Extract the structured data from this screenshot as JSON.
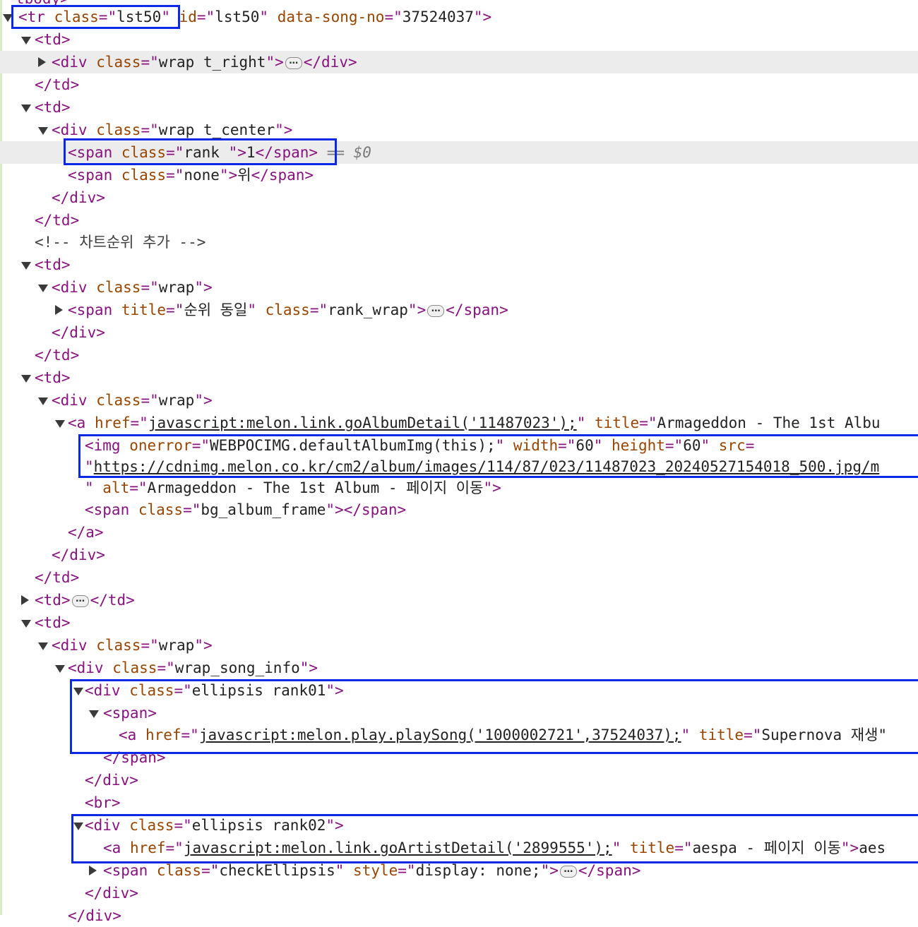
{
  "devtools": {
    "top_cut_text": "tbody>",
    "lines": [
      {
        "indent": 0,
        "caret": "open",
        "segs": [
          {
            "t": "<tr ",
            "c": "tag"
          },
          {
            "t": "class",
            "c": "an"
          },
          {
            "t": "=\"",
            "c": "tag"
          },
          {
            "t": "lst50",
            "c": "av"
          },
          {
            "t": "\"",
            "c": "tag"
          },
          {
            "t": " id",
            "c": "an"
          },
          {
            "t": "=\"",
            "c": "tag"
          },
          {
            "t": "lst50",
            "c": "av"
          },
          {
            "t": "\"",
            "c": "tag"
          },
          {
            "t": " data-song-no",
            "c": "an"
          },
          {
            "t": "=\"",
            "c": "tag"
          },
          {
            "t": "37524037",
            "c": "av"
          },
          {
            "t": "\">",
            "c": "tag"
          }
        ]
      },
      {
        "indent": 1,
        "caret": "open",
        "segs": [
          {
            "t": "<td>",
            "c": "tag"
          }
        ]
      },
      {
        "indent": 2,
        "caret": "closed",
        "sel": true,
        "segs": [
          {
            "t": "<div ",
            "c": "tag"
          },
          {
            "t": "class",
            "c": "an"
          },
          {
            "t": "=\"",
            "c": "tag"
          },
          {
            "t": "wrap t_right",
            "c": "av"
          },
          {
            "t": "\">",
            "c": "tag"
          },
          {
            "t": "…",
            "c": "ell"
          },
          {
            "t": "</div>",
            "c": "tag"
          }
        ]
      },
      {
        "indent": 1,
        "segs": [
          {
            "t": "</td>",
            "c": "tag"
          }
        ]
      },
      {
        "indent": 1,
        "caret": "open",
        "segs": [
          {
            "t": "<td>",
            "c": "tag"
          }
        ]
      },
      {
        "indent": 2,
        "caret": "open",
        "segs": [
          {
            "t": "<div ",
            "c": "tag"
          },
          {
            "t": "class",
            "c": "an"
          },
          {
            "t": "=\"",
            "c": "tag"
          },
          {
            "t": "wrap t_center",
            "c": "av"
          },
          {
            "t": "\">",
            "c": "tag"
          }
        ]
      },
      {
        "indent": 3,
        "sel": true,
        "segs": [
          {
            "t": "<span ",
            "c": "tag"
          },
          {
            "t": "class",
            "c": "an"
          },
          {
            "t": "=\"",
            "c": "tag"
          },
          {
            "t": "rank ",
            "c": "av"
          },
          {
            "t": "\">",
            "c": "tag"
          },
          {
            "t": "1",
            "c": "txt"
          },
          {
            "t": "</span>",
            "c": "tag"
          },
          {
            "t": " == ",
            "c": "sel0"
          },
          {
            "t": "$0",
            "c": "sel0"
          }
        ]
      },
      {
        "indent": 3,
        "segs": [
          {
            "t": "<span ",
            "c": "tag"
          },
          {
            "t": "class",
            "c": "an"
          },
          {
            "t": "=\"",
            "c": "tag"
          },
          {
            "t": "none",
            "c": "av"
          },
          {
            "t": "\">",
            "c": "tag"
          },
          {
            "t": "위",
            "c": "txt"
          },
          {
            "t": "</span>",
            "c": "tag"
          }
        ]
      },
      {
        "indent": 2,
        "segs": [
          {
            "t": "</div>",
            "c": "tag"
          }
        ]
      },
      {
        "indent": 1,
        "segs": [
          {
            "t": "</td>",
            "c": "tag"
          }
        ]
      },
      {
        "indent": 1,
        "segs": [
          {
            "t": "<!-- 차트순위 추가 -->",
            "c": "cm"
          }
        ]
      },
      {
        "indent": 1,
        "caret": "open",
        "segs": [
          {
            "t": "<td>",
            "c": "tag"
          }
        ]
      },
      {
        "indent": 2,
        "caret": "open",
        "segs": [
          {
            "t": "<div ",
            "c": "tag"
          },
          {
            "t": "class",
            "c": "an"
          },
          {
            "t": "=\"",
            "c": "tag"
          },
          {
            "t": "wrap",
            "c": "av"
          },
          {
            "t": "\">",
            "c": "tag"
          }
        ]
      },
      {
        "indent": 3,
        "caret": "closed",
        "segs": [
          {
            "t": "<span ",
            "c": "tag"
          },
          {
            "t": "title",
            "c": "an"
          },
          {
            "t": "=\"",
            "c": "tag"
          },
          {
            "t": "순위 동일",
            "c": "av"
          },
          {
            "t": "\"",
            "c": "tag"
          },
          {
            "t": " class",
            "c": "an"
          },
          {
            "t": "=\"",
            "c": "tag"
          },
          {
            "t": "rank_wrap",
            "c": "av"
          },
          {
            "t": "\">",
            "c": "tag"
          },
          {
            "t": "…",
            "c": "ell"
          },
          {
            "t": "</span>",
            "c": "tag"
          }
        ]
      },
      {
        "indent": 2,
        "segs": [
          {
            "t": "</div>",
            "c": "tag"
          }
        ]
      },
      {
        "indent": 1,
        "segs": [
          {
            "t": "</td>",
            "c": "tag"
          }
        ]
      },
      {
        "indent": 1,
        "caret": "open",
        "segs": [
          {
            "t": "<td>",
            "c": "tag"
          }
        ]
      },
      {
        "indent": 2,
        "caret": "open",
        "segs": [
          {
            "t": "<div ",
            "c": "tag"
          },
          {
            "t": "class",
            "c": "an"
          },
          {
            "t": "=\"",
            "c": "tag"
          },
          {
            "t": "wrap",
            "c": "av"
          },
          {
            "t": "\">",
            "c": "tag"
          }
        ]
      },
      {
        "indent": 3,
        "caret": "open",
        "segs": [
          {
            "t": "<a ",
            "c": "tag"
          },
          {
            "t": "href",
            "c": "an"
          },
          {
            "t": "=\"",
            "c": "tag"
          },
          {
            "t": "javascript:melon.link.goAlbumDetail('11487023');",
            "c": "lnk"
          },
          {
            "t": "\"",
            "c": "tag"
          },
          {
            "t": " title",
            "c": "an"
          },
          {
            "t": "=\"",
            "c": "tag"
          },
          {
            "t": "Armageddon - The 1st Albu",
            "c": "av"
          }
        ]
      },
      {
        "indent": 4,
        "segs": [
          {
            "t": "<img ",
            "c": "tag"
          },
          {
            "t": "onerror",
            "c": "an"
          },
          {
            "t": "=\"",
            "c": "tag"
          },
          {
            "t": "WEBPOCIMG.defaultAlbumImg(this);",
            "c": "av"
          },
          {
            "t": "\"",
            "c": "tag"
          },
          {
            "t": " width",
            "c": "an"
          },
          {
            "t": "=\"",
            "c": "tag"
          },
          {
            "t": "60",
            "c": "av"
          },
          {
            "t": "\"",
            "c": "tag"
          },
          {
            "t": " height",
            "c": "an"
          },
          {
            "t": "=\"",
            "c": "tag"
          },
          {
            "t": "60",
            "c": "av"
          },
          {
            "t": "\"",
            "c": "tag"
          },
          {
            "t": " src",
            "c": "an"
          },
          {
            "t": "=",
            "c": "tag"
          }
        ]
      },
      {
        "indent": 4,
        "segs": [
          {
            "t": "\"",
            "c": "tag"
          },
          {
            "t": "https://cdnimg.melon.co.kr/cm2/album/images/114/87/023/11487023_20240527154018_500.jpg/m",
            "c": "lnk"
          }
        ]
      },
      {
        "indent": 4,
        "segs": [
          {
            "t": "\"",
            "c": "tag"
          },
          {
            "t": " alt",
            "c": "an"
          },
          {
            "t": "=\"",
            "c": "tag"
          },
          {
            "t": "Armageddon - The 1st Album - 페이지 이동",
            "c": "av"
          },
          {
            "t": "\">",
            "c": "tag"
          }
        ]
      },
      {
        "indent": 4,
        "segs": [
          {
            "t": "<span ",
            "c": "tag"
          },
          {
            "t": "class",
            "c": "an"
          },
          {
            "t": "=\"",
            "c": "tag"
          },
          {
            "t": "bg_album_frame",
            "c": "av"
          },
          {
            "t": "\">",
            "c": "tag"
          },
          {
            "t": "</span>",
            "c": "tag"
          }
        ]
      },
      {
        "indent": 3,
        "segs": [
          {
            "t": "</a>",
            "c": "tag"
          }
        ]
      },
      {
        "indent": 2,
        "segs": [
          {
            "t": "</div>",
            "c": "tag"
          }
        ]
      },
      {
        "indent": 1,
        "segs": [
          {
            "t": "</td>",
            "c": "tag"
          }
        ]
      },
      {
        "indent": 1,
        "caret": "closed",
        "segs": [
          {
            "t": "<td>",
            "c": "tag"
          },
          {
            "t": "…",
            "c": "ell"
          },
          {
            "t": "</td>",
            "c": "tag"
          }
        ]
      },
      {
        "indent": 1,
        "caret": "open",
        "segs": [
          {
            "t": "<td>",
            "c": "tag"
          }
        ]
      },
      {
        "indent": 2,
        "caret": "open",
        "segs": [
          {
            "t": "<div ",
            "c": "tag"
          },
          {
            "t": "class",
            "c": "an"
          },
          {
            "t": "=\"",
            "c": "tag"
          },
          {
            "t": "wrap",
            "c": "av"
          },
          {
            "t": "\">",
            "c": "tag"
          }
        ]
      },
      {
        "indent": 3,
        "caret": "open",
        "segs": [
          {
            "t": "<div ",
            "c": "tag"
          },
          {
            "t": "class",
            "c": "an"
          },
          {
            "t": "=\"",
            "c": "tag"
          },
          {
            "t": "wrap_song_info",
            "c": "av"
          },
          {
            "t": "\">",
            "c": "tag"
          }
        ]
      },
      {
        "indent": 4,
        "caret": "open",
        "segs": [
          {
            "t": "<div ",
            "c": "tag"
          },
          {
            "t": "class",
            "c": "an"
          },
          {
            "t": "=\"",
            "c": "tag"
          },
          {
            "t": "ellipsis rank01",
            "c": "av"
          },
          {
            "t": "\">",
            "c": "tag"
          }
        ]
      },
      {
        "indent": 5,
        "caret": "open",
        "segs": [
          {
            "t": "<span>",
            "c": "tag"
          }
        ]
      },
      {
        "indent": 6,
        "segs": [
          {
            "t": "<a ",
            "c": "tag"
          },
          {
            "t": "href",
            "c": "an"
          },
          {
            "t": "=\"",
            "c": "tag"
          },
          {
            "t": "javascript:melon.play.playSong('1000002721',37524037);",
            "c": "lnk"
          },
          {
            "t": "\"",
            "c": "tag"
          },
          {
            "t": " title",
            "c": "an"
          },
          {
            "t": "=\"",
            "c": "tag"
          },
          {
            "t": "Supernova 재생\"",
            "c": "av"
          }
        ]
      },
      {
        "indent": 5,
        "segs": [
          {
            "t": "</span>",
            "c": "tag"
          }
        ]
      },
      {
        "indent": 4,
        "segs": [
          {
            "t": "</div>",
            "c": "tag"
          }
        ]
      },
      {
        "indent": 4,
        "segs": [
          {
            "t": "<br>",
            "c": "tag"
          }
        ]
      },
      {
        "indent": 4,
        "caret": "open",
        "segs": [
          {
            "t": "<div ",
            "c": "tag"
          },
          {
            "t": "class",
            "c": "an"
          },
          {
            "t": "=\"",
            "c": "tag"
          },
          {
            "t": "ellipsis rank02",
            "c": "av"
          },
          {
            "t": "\">",
            "c": "tag"
          }
        ]
      },
      {
        "indent": 5,
        "segs": [
          {
            "t": "<a ",
            "c": "tag"
          },
          {
            "t": "href",
            "c": "an"
          },
          {
            "t": "=\"",
            "c": "tag"
          },
          {
            "t": "javascript:melon.link.goArtistDetail('2899555');",
            "c": "lnk"
          },
          {
            "t": "\"",
            "c": "tag"
          },
          {
            "t": " title",
            "c": "an"
          },
          {
            "t": "=\"",
            "c": "tag"
          },
          {
            "t": "aespa - 페이지 이동",
            "c": "av"
          },
          {
            "t": "\">",
            "c": "tag"
          },
          {
            "t": "aes",
            "c": "txt"
          }
        ]
      },
      {
        "indent": 5,
        "caret": "closed",
        "segs": [
          {
            "t": "<span ",
            "c": "tag"
          },
          {
            "t": "class",
            "c": "an"
          },
          {
            "t": "=\"",
            "c": "tag"
          },
          {
            "t": "checkEllipsis",
            "c": "av"
          },
          {
            "t": "\"",
            "c": "tag"
          },
          {
            "t": " style",
            "c": "an"
          },
          {
            "t": "=\"",
            "c": "tag"
          },
          {
            "t": "display: none;",
            "c": "av"
          },
          {
            "t": "\">",
            "c": "tag"
          },
          {
            "t": "…",
            "c": "ell"
          },
          {
            "t": "</span>",
            "c": "tag"
          }
        ]
      },
      {
        "indent": 4,
        "segs": [
          {
            "t": "</div>",
            "c": "tag"
          }
        ]
      },
      {
        "indent": 3,
        "segs": [
          {
            "t": "</div>",
            "c": "tag"
          }
        ]
      }
    ]
  }
}
